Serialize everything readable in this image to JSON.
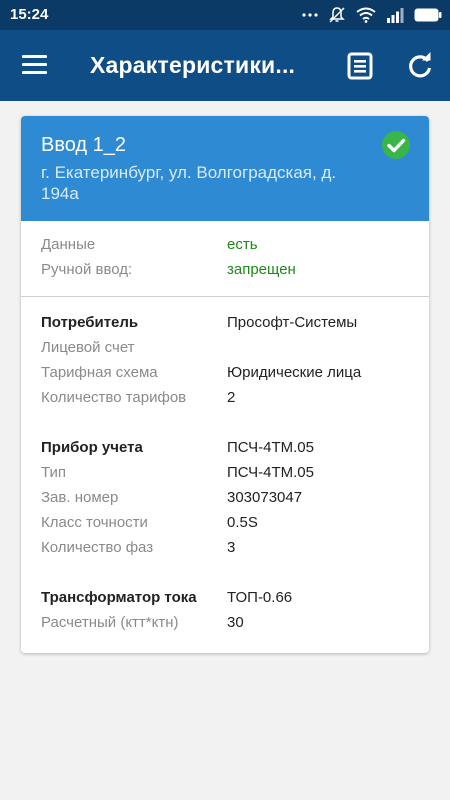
{
  "status_bar": {
    "time": "15:24"
  },
  "app_bar": {
    "title": "Характеристики..."
  },
  "card": {
    "title": "Ввод 1_2",
    "address": "г. Екатеринбург, ул. Волгоградская, д. 194а",
    "status": "check-icon",
    "data_section": [
      {
        "label": "Данные",
        "value": "есть",
        "value_color": "#1c8a16"
      },
      {
        "label": "Ручной ввод:",
        "value": "запрещен",
        "value_color": "#1c8a16"
      }
    ],
    "consumer": {
      "heading": "Потребитель",
      "heading_value": "Прософт-Системы",
      "rows": [
        {
          "label": "Лицевой счет",
          "value": ""
        },
        {
          "label": "Тарифная схема",
          "value": "Юридические лица"
        },
        {
          "label": "Количество тарифов",
          "value": "2"
        }
      ]
    },
    "meter": {
      "heading": "Прибор учета",
      "heading_value": "ПСЧ-4ТМ.05",
      "rows": [
        {
          "label": "Тип",
          "value": "ПСЧ-4ТМ.05"
        },
        {
          "label": "Зав. номер",
          "value": "303073047"
        },
        {
          "label": "Класс точности",
          "value": "0.5S"
        },
        {
          "label": "Количество фаз",
          "value": "3"
        }
      ]
    },
    "transformer": {
      "heading": "Трансформатор тока",
      "heading_value": "ТОП-0.66",
      "rows": [
        {
          "label": "Расчетный (ктт*ктн)",
          "value": "30"
        }
      ]
    }
  },
  "colors": {
    "status_bar": "#0c3a66",
    "app_bar": "#0f4d86",
    "card_header": "#2f8ad4",
    "check": "#39b54a",
    "ok_text": "#1c8a16"
  }
}
